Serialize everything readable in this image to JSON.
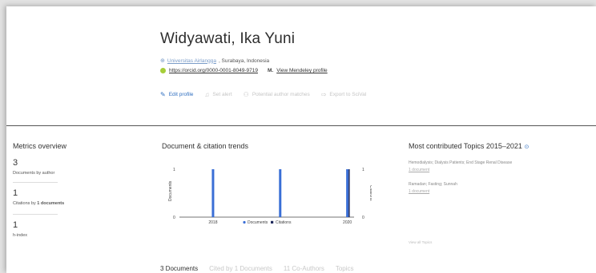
{
  "author": {
    "name": "Widyawati, Ika Yuni",
    "affiliation_org": "Universitas Airlangga",
    "affiliation_loc": ", Surabaya, Indonesia",
    "orcid_url": "https://orcid.org/0000-0001-8049-9719",
    "mendeley_link": "View Mendeley profile"
  },
  "actions": [
    {
      "label": "Edit profile",
      "icon": "pencil-icon"
    },
    {
      "label": "Set alert",
      "icon": "bell-icon"
    },
    {
      "label": "Potential author matches",
      "icon": "people-icon"
    },
    {
      "label": "Export to SciVal",
      "icon": "export-icon"
    }
  ],
  "metrics": {
    "title": "Metrics overview",
    "documents": {
      "value": "3",
      "label": "Documents by author"
    },
    "citations": {
      "value": "1",
      "label_prefix": "Citations by ",
      "label_bold": "1 documents"
    },
    "hindex": {
      "value": "1",
      "label": "h-index"
    }
  },
  "trends": {
    "title": "Document & citation trends"
  },
  "chart_data": {
    "type": "bar",
    "categories": [
      "2018",
      "2019",
      "2020"
    ],
    "series": [
      {
        "name": "Documents",
        "values": [
          1,
          1,
          1
        ],
        "color": "#3a6fd6"
      },
      {
        "name": "Citations",
        "values": [
          0,
          0,
          1
        ],
        "color": "#1f2a5c"
      }
    ],
    "x_tick_labels": [
      "2018",
      "2020"
    ],
    "ylabel": "Documents",
    "y2label": "Citations",
    "ylim": [
      0,
      1
    ],
    "y_ticks": [
      "0",
      "1"
    ],
    "y2lim": [
      0,
      1
    ],
    "y2_ticks": [
      "0",
      "1"
    ],
    "legend": [
      "Documents",
      "Citations"
    ],
    "legend_position": "bottom"
  },
  "topics": {
    "title": "Most contributed Topics 2015–2021",
    "items": [
      {
        "name": "Hemodialysis; Dialysis Patients; End Stage Renal Disease",
        "docs": "1 document"
      },
      {
        "name": "Ramadan; Fasting; Sunnah",
        "docs": "1 document"
      }
    ],
    "view_all": "View all Topics"
  },
  "tabs": [
    {
      "label": "3 Documents",
      "active": true
    },
    {
      "label": "Cited by 1 Documents",
      "active": false
    },
    {
      "label": "11 Co-Authors",
      "active": false
    },
    {
      "label": "Topics",
      "active": false
    }
  ]
}
